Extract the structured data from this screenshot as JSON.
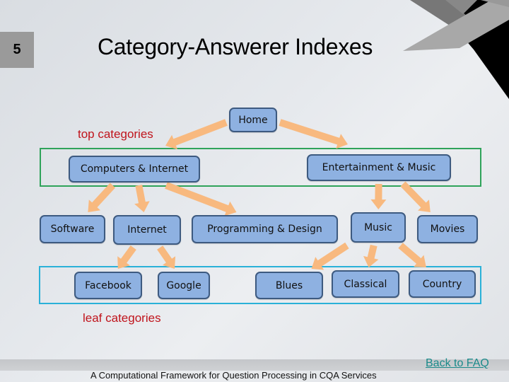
{
  "slide": {
    "number": "5",
    "title": "Category-Answerer Indexes"
  },
  "labels": {
    "top_categories": "top categories",
    "leaf_categories": "leaf categories"
  },
  "nodes": {
    "home": "Home",
    "computers_internet": "Computers & Internet",
    "entertainment_music": "Entertainment & Music",
    "software": "Software",
    "internet": "Internet",
    "programming_design": "Programming & Design",
    "music": "Music",
    "movies": "Movies",
    "facebook": "Facebook",
    "google": "Google",
    "blues": "Blues",
    "classical": "Classical",
    "country": "Country"
  },
  "edges": [
    [
      "home",
      "computers_internet"
    ],
    [
      "home",
      "entertainment_music"
    ],
    [
      "computers_internet",
      "software"
    ],
    [
      "computers_internet",
      "internet"
    ],
    [
      "computers_internet",
      "programming_design"
    ],
    [
      "entertainment_music",
      "music"
    ],
    [
      "entertainment_music",
      "movies"
    ],
    [
      "internet",
      "facebook"
    ],
    [
      "internet",
      "google"
    ],
    [
      "music",
      "blues"
    ],
    [
      "music",
      "classical"
    ],
    [
      "music",
      "country"
    ]
  ],
  "colors": {
    "node_fill": "#8eb1e1",
    "node_border": "#3d5a80",
    "arrow": "#f8b97f",
    "top_band": "#2fa35a",
    "leaf_band": "#2ab1d8",
    "label_red": "#c0141c",
    "link": "#1a8a8a"
  },
  "footer": {
    "text": "A Computational Framework for Question Processing in CQA Services",
    "back_link": "Back to FAQ"
  }
}
